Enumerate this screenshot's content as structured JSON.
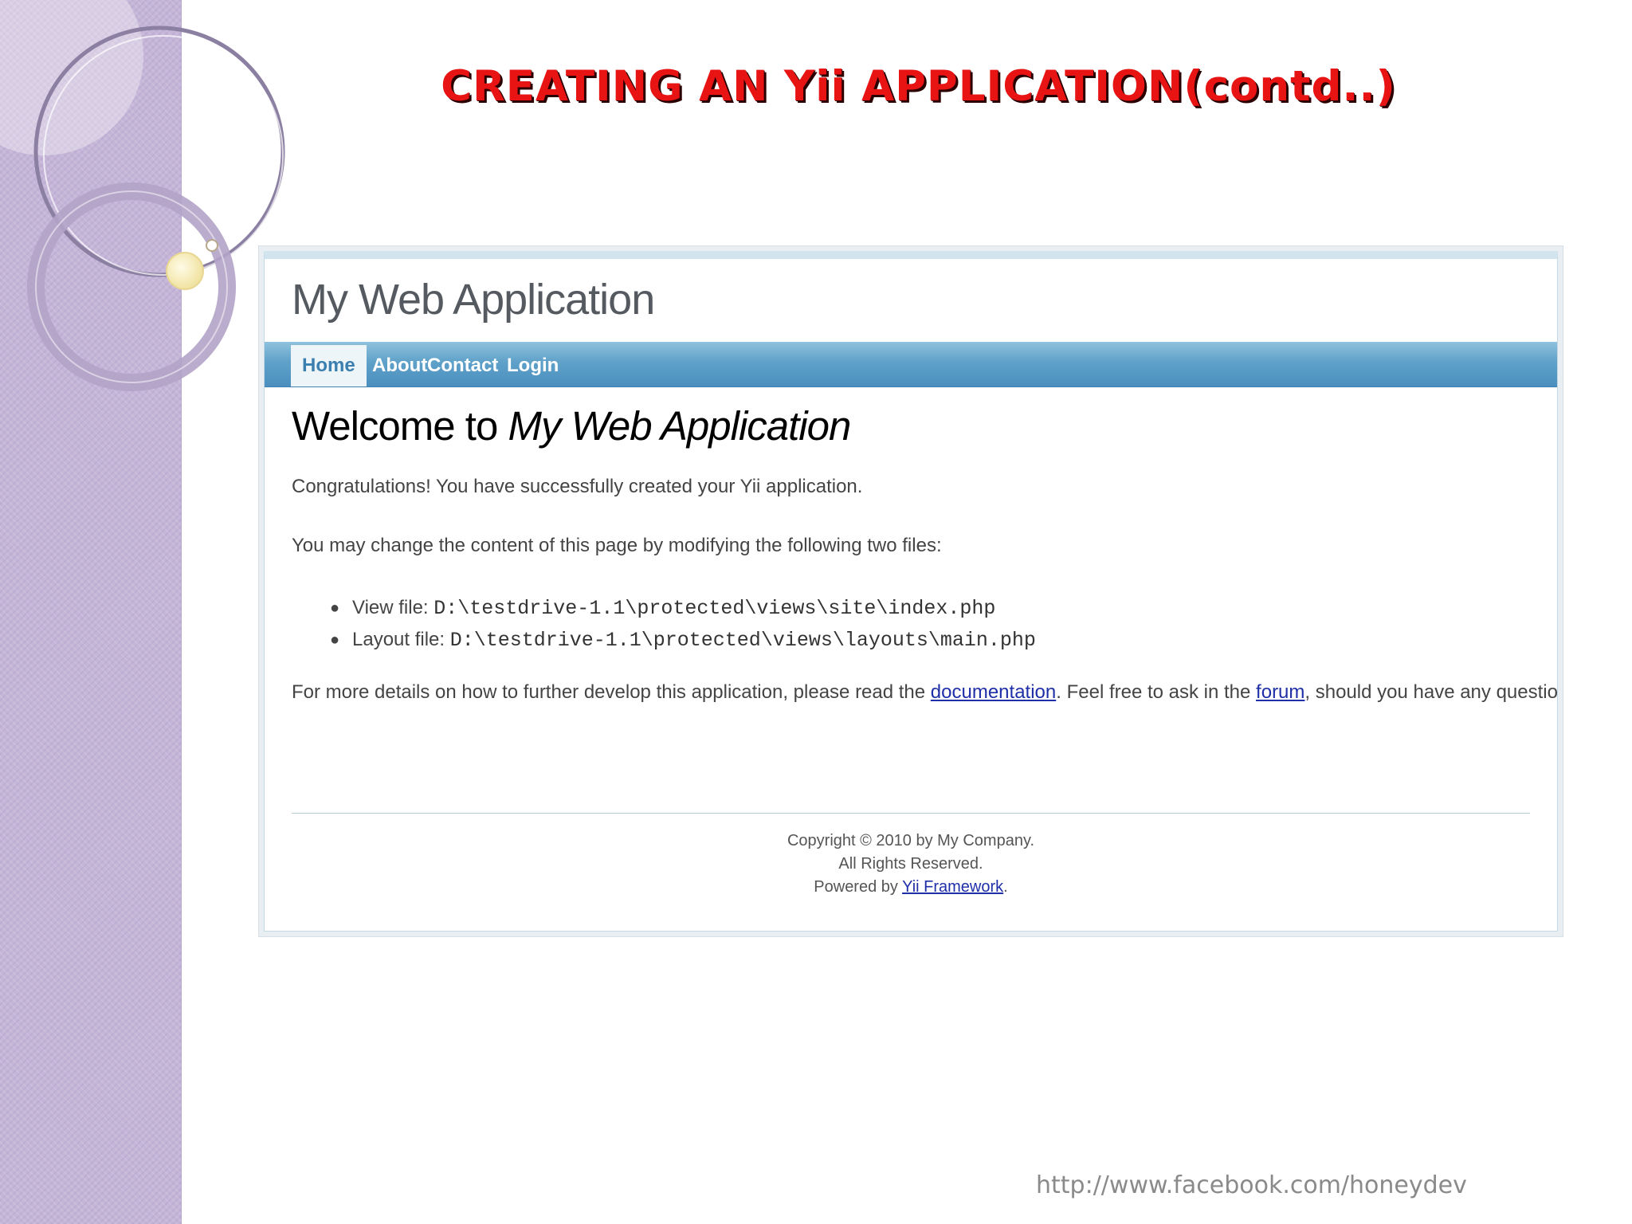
{
  "slide": {
    "title": "CREATING AN Yii APPLICATION(contd..)",
    "footer_url": "http://www.facebook.com/honeydev"
  },
  "app": {
    "logo": "My Web Application",
    "menu": [
      {
        "label": "Home",
        "active": true
      },
      {
        "label": "About",
        "active": false
      },
      {
        "label": "Contact",
        "active": false
      },
      {
        "label": "Login",
        "active": false
      }
    ],
    "heading_prefix": "Welcome to ",
    "heading_em": "My Web Application",
    "congrats": "Congratulations! You have successfully created your Yii application.",
    "change_note": "You may change the content of this page by modifying the following two files:",
    "files": [
      {
        "label": "View file: ",
        "path": "D:\\testdrive-1.1\\protected\\views\\site\\index.php"
      },
      {
        "label": "Layout file: ",
        "path": "D:\\testdrive-1.1\\protected\\views\\layouts\\main.php"
      }
    ],
    "details": {
      "part1": "For more details on how to further develop this application, please read the ",
      "link1": "documentation",
      "part2": ". Feel free to ask in the ",
      "link2": "forum",
      "part3": ", should you have any questions."
    },
    "footer": {
      "copyright": "Copyright © 2010 by My Company.",
      "rights": "All Rights Reserved.",
      "powered_prefix": "Powered by ",
      "powered_link": "Yii Framework",
      "powered_suffix": "."
    }
  },
  "colors": {
    "title_red": "#e81414",
    "menu_blue": "#5fa1c9",
    "link_blue": "#1f2fa8",
    "band_purple": "#c5b6d8"
  },
  "icons": {
    "bullet": "bullet-icon"
  }
}
